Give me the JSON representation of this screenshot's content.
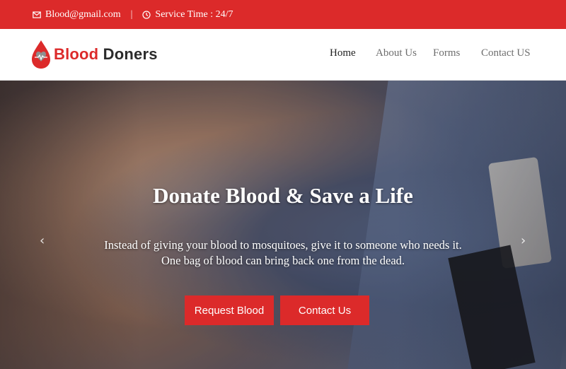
{
  "topbar": {
    "email": "Blood@gmail.com",
    "separator": "|",
    "service": "Service Time : 24/7",
    "icons": [
      "envelope-icon",
      "clock-icon"
    ]
  },
  "brand": {
    "part1": "Blood",
    "part2": "Doners",
    "logo_icon": "blood-drop-heart-icon"
  },
  "nav": {
    "items": [
      {
        "label": "Home",
        "active": true
      },
      {
        "label": "About Us",
        "active": false
      },
      {
        "label": "Forms",
        "active": false
      },
      {
        "label": "Contact US",
        "active": false
      }
    ]
  },
  "hero": {
    "title": "Donate Blood & Save a Life",
    "line1": "Instead of giving your blood to mosquitoes, give it to someone who needs it.",
    "line2": "One bag of blood can bring back one from the dead.",
    "buttons": {
      "request": "Request Blood",
      "contact": "Contact Us"
    },
    "arrows": {
      "prev": "‹",
      "next": "›"
    }
  },
  "colors": {
    "accent": "#dc2a2a",
    "nav_active": "#1f1f1f",
    "nav_inactive": "#6d6d6d"
  }
}
